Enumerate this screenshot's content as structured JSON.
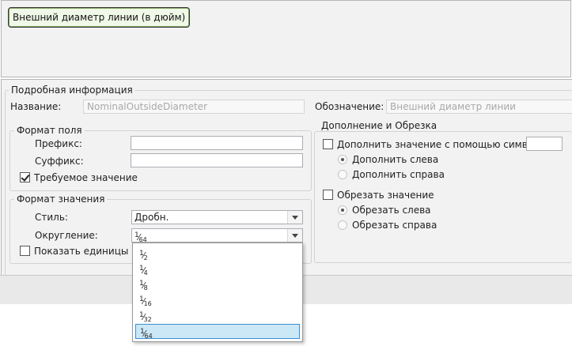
{
  "top": {
    "chip_text": "Внешний диаметр линии (в дюйм)"
  },
  "details": {
    "title": "Подробная информация",
    "name_label": "Название:",
    "name_value": "NominalOutsideDiameter",
    "designation_label": "Обозначение:",
    "designation_value": "Внешний диаметр линии"
  },
  "field_format": {
    "title": "Формат поля",
    "prefix_label": "Префикс:",
    "prefix_value": "",
    "suffix_label": "Суффикс:",
    "suffix_value": "",
    "required_label": "Требуемое значение",
    "required_checked": true
  },
  "value_format": {
    "title": "Формат значения",
    "style_label": "Стиль:",
    "style_value": "Дробн.",
    "rounding_label": "Округление:",
    "rounding_value": {
      "num": "1",
      "den": "64"
    },
    "show_units_label": "Показать единицы",
    "show_units_checked": false
  },
  "rounding_options": [
    {
      "num": "1",
      "den": "2"
    },
    {
      "num": "1",
      "den": "4"
    },
    {
      "num": "1",
      "den": "8"
    },
    {
      "num": "1",
      "den": "16"
    },
    {
      "num": "1",
      "den": "32"
    },
    {
      "num": "1",
      "den": "64"
    }
  ],
  "rounding_selected_index": 5,
  "padding_trim": {
    "title": "Дополнение и Обрезка",
    "pad_label": "Дополнить значение с помощью символа",
    "pad_checked": false,
    "pad_char_value": "",
    "pad_left_label": "Дополнить слева",
    "pad_right_label": "Дополнить справа",
    "pad_side_selected": "left",
    "trim_label": "Обрезать значение",
    "trim_checked": false,
    "trim_left_label": "Обрезать слева",
    "trim_right_label": "Обрезать справа",
    "trim_side_selected": "left"
  },
  "colors": {
    "panel_bg": "#f2f2f2",
    "selection_bg": "#cce8f6",
    "selection_border": "#3b8ed0",
    "chip_bg": "#f0f8e8"
  }
}
